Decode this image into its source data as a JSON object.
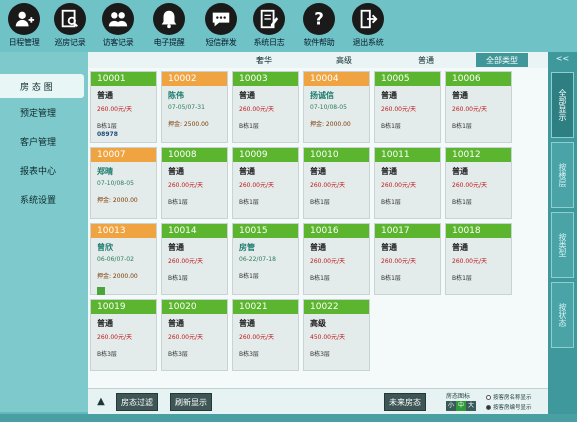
{
  "toolbar": {
    "items": [
      {
        "label": "日程管理",
        "icon": "user-plus-icon"
      },
      {
        "label": "巡房记录",
        "icon": "clipboard-search-icon"
      },
      {
        "label": "访客记录",
        "icon": "users-icon"
      },
      {
        "label": "电子提醒",
        "icon": "bell-icon"
      },
      {
        "label": "短信群发",
        "icon": "chat-icon"
      },
      {
        "label": "系统日志",
        "icon": "document-edit-icon"
      },
      {
        "label": "软件帮助",
        "icon": "question-icon"
      },
      {
        "label": "退出系统",
        "icon": "exit-icon"
      }
    ]
  },
  "sidebar": {
    "items": [
      {
        "label": "房 态 图"
      },
      {
        "label": "预定管理"
      },
      {
        "label": "客户管理"
      },
      {
        "label": "报表中心"
      },
      {
        "label": "系统设置"
      }
    ]
  },
  "tabs": [
    {
      "label": "奢华"
    },
    {
      "label": "高级"
    },
    {
      "label": "普通"
    },
    {
      "label": "全部类型"
    }
  ],
  "rooms": [
    {
      "no": "10001",
      "head": "green",
      "type": "普通",
      "price": "260.00元/天",
      "floor": "B栋1层",
      "code": "08978"
    },
    {
      "no": "10002",
      "head": "orange",
      "guest": "陈伟",
      "date": "07-05/07-31",
      "deposit": "押金: 2500.00"
    },
    {
      "no": "10003",
      "head": "green",
      "type": "普通",
      "price": "260.00元/天",
      "floor": "B栋1层"
    },
    {
      "no": "10004",
      "head": "orange",
      "guest": "扬诚信",
      "date": "07-10/08-05",
      "deposit": "押金: 2000.00"
    },
    {
      "no": "10005",
      "head": "green",
      "type": "普通",
      "price": "260.00元/天",
      "floor": "B栋1层"
    },
    {
      "no": "10006",
      "head": "green",
      "type": "普通",
      "price": "260.00元/天",
      "floor": "B栋1层"
    },
    {
      "no": "10007",
      "head": "orange",
      "guest": "郑晴",
      "date": "07-10/08-05",
      "deposit": "押金: 2000.00"
    },
    {
      "no": "10008",
      "head": "green",
      "type": "普通",
      "price": "260.00元/天",
      "floor": "B栋1层"
    },
    {
      "no": "10009",
      "head": "green",
      "type": "普通",
      "price": "260.00元/天",
      "floor": "B栋1层"
    },
    {
      "no": "10010",
      "head": "green",
      "type": "普通",
      "price": "260.00元/天",
      "floor": "B栋1层"
    },
    {
      "no": "10011",
      "head": "green",
      "type": "普通",
      "price": "260.00元/天",
      "floor": "B栋1层"
    },
    {
      "no": "10012",
      "head": "green",
      "type": "普通",
      "price": "260.00元/天",
      "floor": "B栋1层"
    },
    {
      "no": "10013",
      "head": "orange",
      "guest": "曾欣",
      "date": "06-06/07-02",
      "deposit": "押金: 2000.00",
      "badge": true
    },
    {
      "no": "10014",
      "head": "green",
      "type": "普通",
      "price": "260.00元/天",
      "floor": "B栋1层"
    },
    {
      "no": "10015",
      "head": "green",
      "guest": "房管",
      "date": "06-22/07-18",
      "floor": "B栋1层"
    },
    {
      "no": "10016",
      "head": "green",
      "type": "普通",
      "price": "260.00元/天",
      "floor": "B栋1层"
    },
    {
      "no": "10017",
      "head": "green",
      "type": "普通",
      "price": "260.00元/天",
      "floor": "B栋1层"
    },
    {
      "no": "10018",
      "head": "green",
      "type": "普通",
      "price": "260.00元/天",
      "floor": "B栋1层"
    },
    {
      "no": "10019",
      "head": "green",
      "type": "普通",
      "price": "260.00元/天",
      "floor": "B栋3层"
    },
    {
      "no": "10020",
      "head": "green",
      "type": "普通",
      "price": "260.00元/天",
      "floor": "B栋3层"
    },
    {
      "no": "10021",
      "head": "green",
      "type": "普通",
      "price": "260.00元/天",
      "floor": "B栋3层"
    },
    {
      "no": "10022",
      "head": "green",
      "type": "高级",
      "price": "450.00元/天",
      "floor": "B栋3层"
    }
  ],
  "bottom": {
    "filter_label": "房态过滤",
    "refresh_label": "刷新显示",
    "future_label": "未来房态",
    "legend_label": "房态图标",
    "sizes": [
      "小",
      "中",
      "大"
    ],
    "radio_name": "按客房名称显示",
    "radio_number": "按客房编号显示"
  },
  "rightbar": {
    "collapse": "<<",
    "tabs": [
      "全部显示",
      "按楼层",
      "按类型",
      "按状态"
    ]
  },
  "colors": {
    "green": "#5cb52f",
    "orange": "#f0a441",
    "teal": "#3f979a"
  }
}
